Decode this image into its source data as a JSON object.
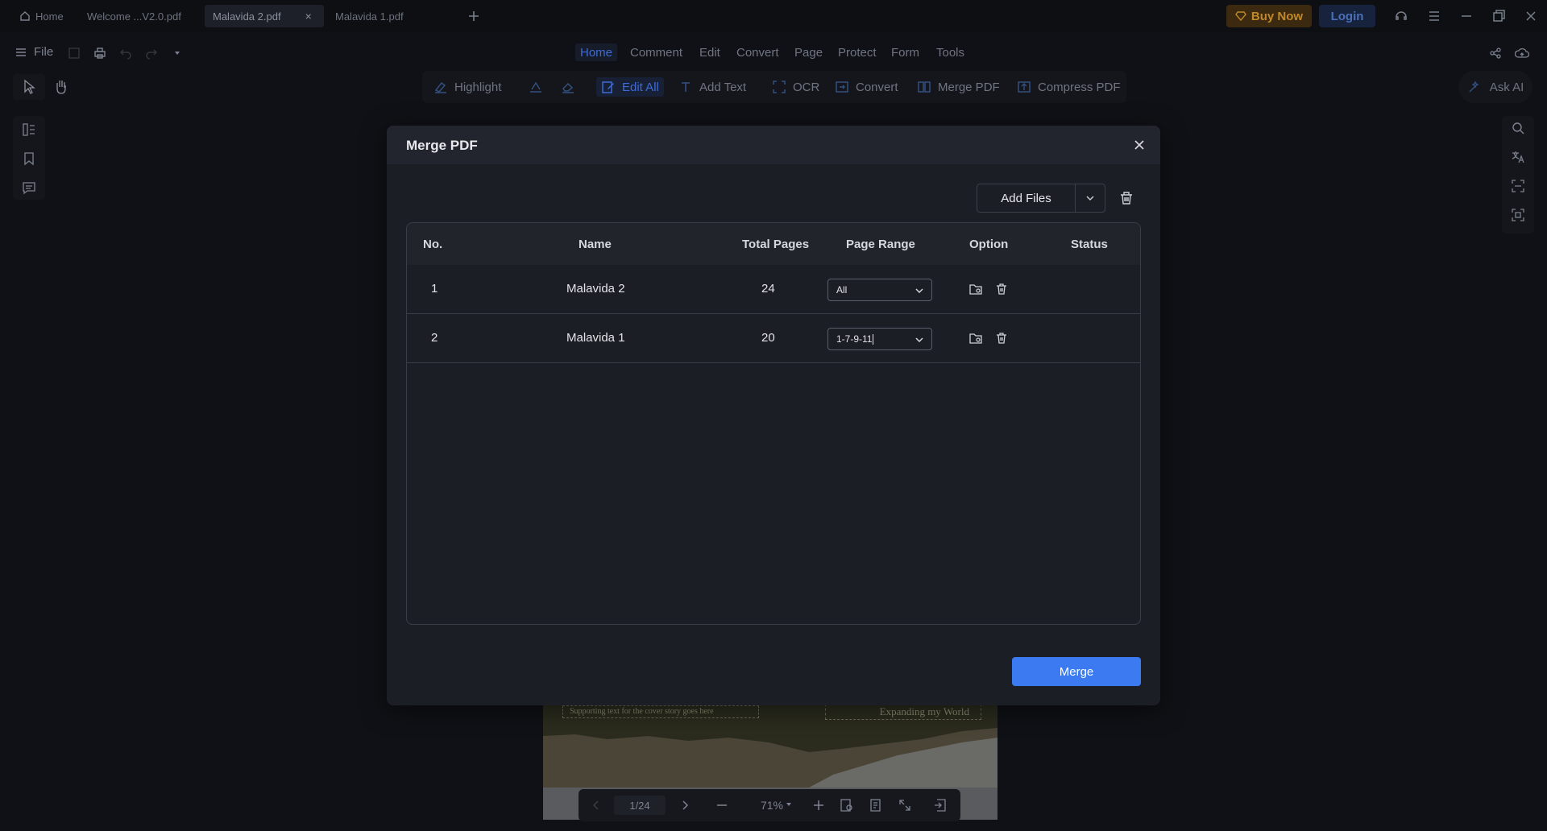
{
  "tabs": [
    {
      "label": "Home"
    },
    {
      "label": "Welcome ...V2.0.pdf"
    },
    {
      "label": "Malavida 2.pdf"
    },
    {
      "label": "Malavida 1.pdf"
    }
  ],
  "topbar": {
    "buy_now": "Buy Now",
    "login": "Login"
  },
  "file_menu": {
    "label": "File"
  },
  "menu": [
    "Home",
    "Comment",
    "Edit",
    "Convert",
    "Page",
    "Protect",
    "Form",
    "Tools"
  ],
  "toolbar": {
    "highlight": "Highlight",
    "edit_all": "Edit All",
    "add_text": "Add Text",
    "ocr": "OCR",
    "convert": "Convert",
    "merge_pdf": "Merge PDF",
    "compress_pdf": "Compress PDF",
    "ask_ai": "Ask AI"
  },
  "document": {
    "supporting_text": "Supporting text for the cover story goes here",
    "heading": "Expanding my World"
  },
  "page_nav": {
    "page": "1/24",
    "zoom": "71%"
  },
  "modal": {
    "title": "Merge PDF",
    "add_files": "Add Files",
    "columns": {
      "no": "No.",
      "name": "Name",
      "total_pages": "Total Pages",
      "page_range": "Page Range",
      "option": "Option",
      "status": "Status"
    },
    "rows": [
      {
        "no": "1",
        "name": "Malavida 2",
        "total_pages": "24",
        "page_range": "All",
        "status": ""
      },
      {
        "no": "2",
        "name": "Malavida 1",
        "total_pages": "20",
        "page_range": "1-7-9-11",
        "status": ""
      }
    ],
    "merge_button": "Merge"
  },
  "colors": {
    "accent": "#3b7af0",
    "buy_now": "#c0882a",
    "active_menu": "#3e6bd6"
  }
}
